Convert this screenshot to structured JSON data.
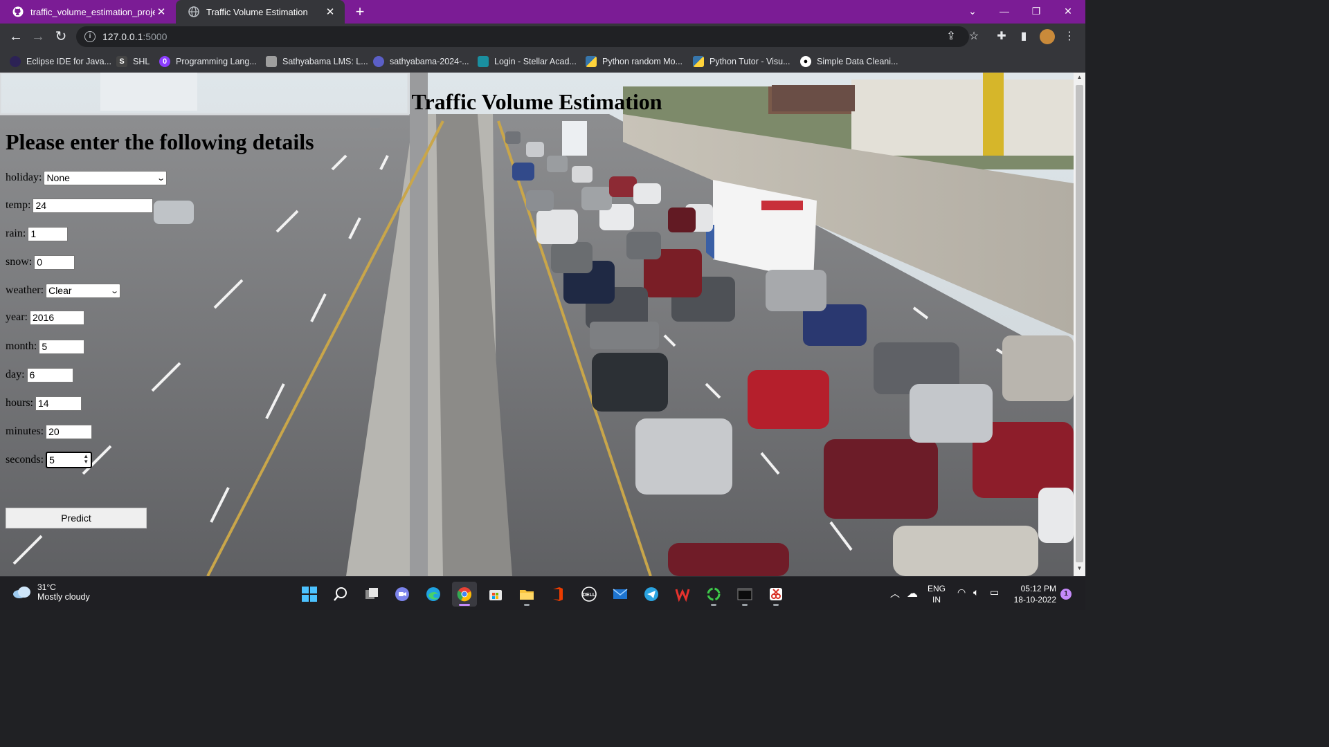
{
  "browser": {
    "tabs": [
      {
        "title": "traffic_volume_estimation_projec",
        "close": "✕"
      },
      {
        "title": "Traffic Volume Estimation",
        "close": "✕"
      }
    ],
    "new_tab": "+",
    "url_host": "127.0.0.1",
    "url_port": ":5000",
    "bookmarks": [
      {
        "label": "Eclipse IDE for Java...",
        "icon": "eclipse-icon",
        "color": "#2c2255"
      },
      {
        "label": "SHL",
        "icon": "shl-icon",
        "color": "#444"
      },
      {
        "label": "Programming Lang...",
        "icon": "programming-icon",
        "color": "#8b3dff"
      },
      {
        "label": "Sathyabama LMS: L...",
        "icon": "lms-icon",
        "color": "#9e9e9e"
      },
      {
        "label": "sathyabama-2024-...",
        "icon": "teams-icon",
        "color": "#5b5fc7"
      },
      {
        "label": "Login - Stellar Acad...",
        "icon": "stellar-icon",
        "color": "#1a8fa0"
      },
      {
        "label": "Python random Mo...",
        "icon": "python-icon",
        "color": "#3776ab"
      },
      {
        "label": "Python Tutor - Visu...",
        "icon": "python-tutor-icon",
        "color": "#3776ab"
      },
      {
        "label": "Simple Data Cleani...",
        "icon": "medium-icon",
        "color": "#000"
      }
    ]
  },
  "page": {
    "title": "Traffic Volume Estimation",
    "heading": "Please enter the following details",
    "fields": {
      "holiday": {
        "label": "holiday:",
        "value": "None"
      },
      "temp": {
        "label": "temp:",
        "value": "24"
      },
      "rain": {
        "label": "rain:",
        "value": "1"
      },
      "snow": {
        "label": "snow:",
        "value": "0"
      },
      "weather": {
        "label": "weather:",
        "value": "Clear"
      },
      "year": {
        "label": "year:",
        "value": "2016"
      },
      "month": {
        "label": "month:",
        "value": "5"
      },
      "day": {
        "label": "day:",
        "value": "6"
      },
      "hours": {
        "label": "hours:",
        "value": "14"
      },
      "minutes": {
        "label": "minutes:",
        "value": "20"
      },
      "seconds": {
        "label": "seconds:",
        "value": "5"
      }
    },
    "predict_label": "Predict"
  },
  "taskbar": {
    "weather_temp": "31°C",
    "weather_cond": "Mostly cloudy",
    "lang_1": "ENG",
    "lang_2": "IN",
    "time": "05:12 PM",
    "date": "18-10-2022",
    "notifications": "1",
    "accent": "#c58af9"
  },
  "colors": {
    "tabstrip": "#7b1c95",
    "toolbar": "#35363a"
  }
}
